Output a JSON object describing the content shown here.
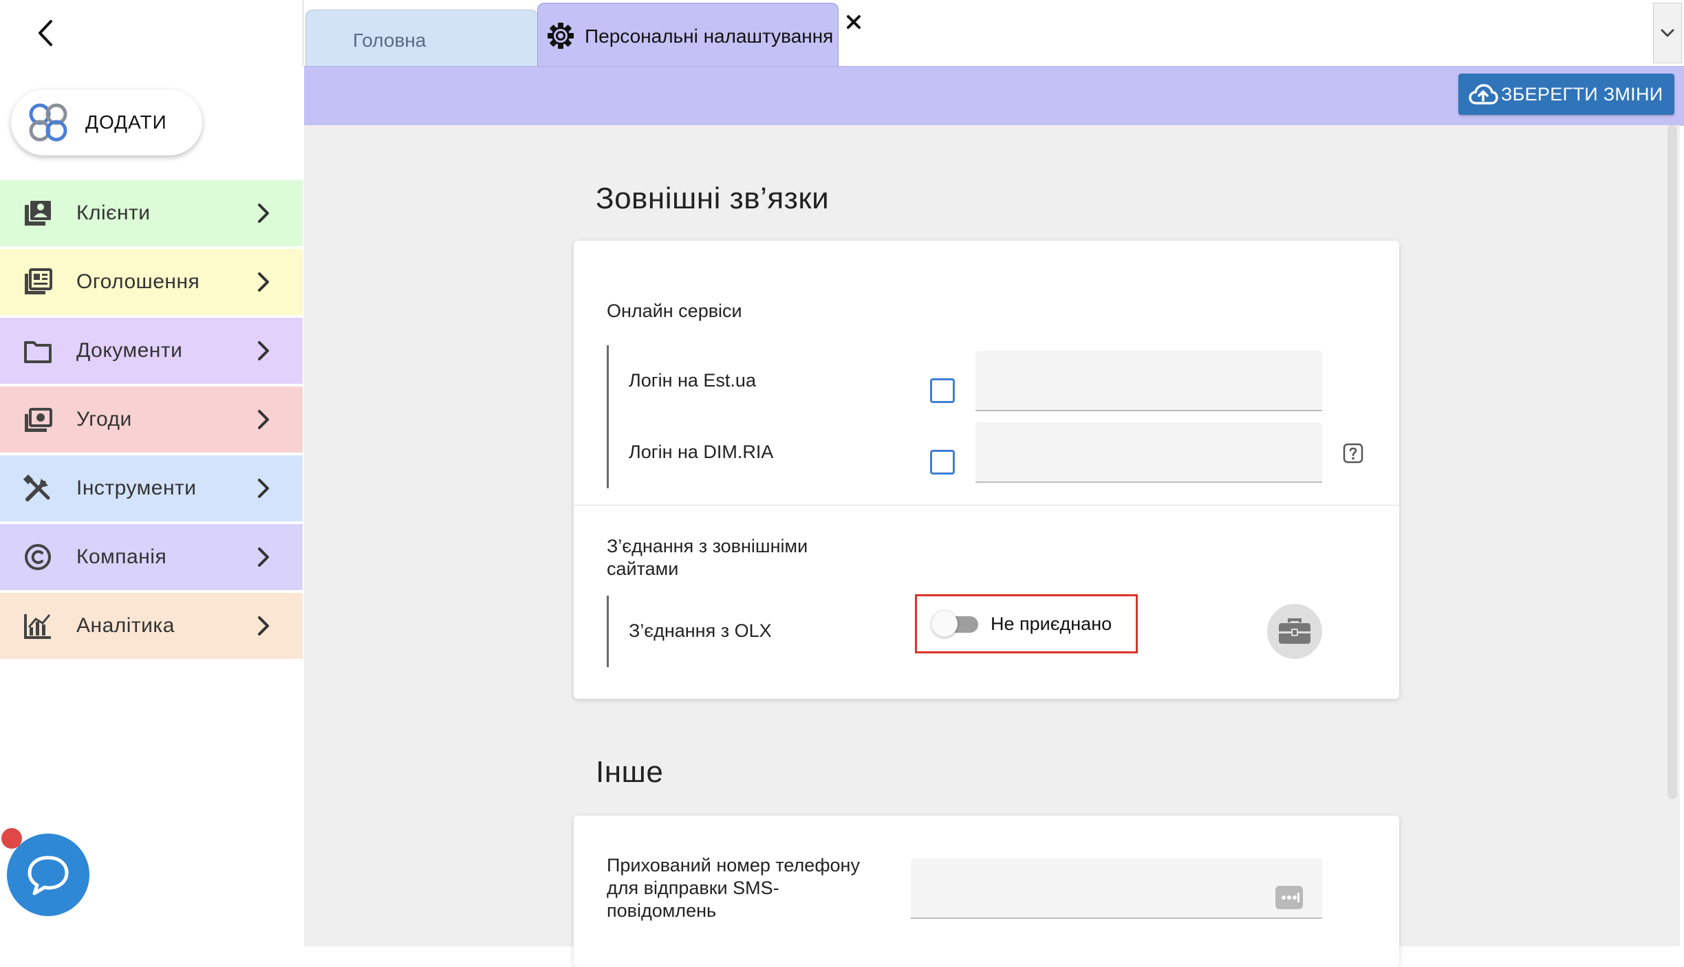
{
  "sidebar": {
    "add_label": "ДОДАТИ",
    "items": [
      {
        "label": "Клієнти",
        "icon": "contacts-book-icon",
        "bg": "#dcfbd7"
      },
      {
        "label": "Оголошення",
        "icon": "listings-icon",
        "bg": "#fdfbcb"
      },
      {
        "label": "Документи",
        "icon": "folder-icon",
        "bg": "#e2d2fb"
      },
      {
        "label": "Угоди",
        "icon": "money-icon",
        "bg": "#f8d2d2"
      },
      {
        "label": "Інструменти",
        "icon": "tools-icon",
        "bg": "#d3e3fb"
      },
      {
        "label": "Компанія",
        "icon": "copyright-icon",
        "bg": "#d9d3fb"
      },
      {
        "label": "Аналітика",
        "icon": "analytics-icon",
        "bg": "#fbe6d3"
      }
    ]
  },
  "tabs": {
    "home_label": "Головна",
    "settings_label": "Персональні налаштування"
  },
  "toolbar": {
    "save_label": "ЗБЕРЕГТИ ЗМІНИ"
  },
  "external": {
    "title": "Зовнішні зв’язки",
    "online_services_title": "Онлайн сервіси",
    "est_label": "Логін на Est.ua",
    "dimria_label": "Логін на DIM.RIA",
    "connections_title": "З’єднання з зовнішніми сайтами",
    "olx_label": "З’єднання з OLX",
    "olx_status": "Не приєднано"
  },
  "other": {
    "title": "Інше",
    "hidden_phone_label": "Прихований номер телефону для відправки SMS-повідомлень"
  },
  "colors": {
    "accent_tab": "#c3c1f5",
    "save_button": "#3074b9",
    "highlight": "#d9332a",
    "checkbox": "#3f7fd6"
  }
}
